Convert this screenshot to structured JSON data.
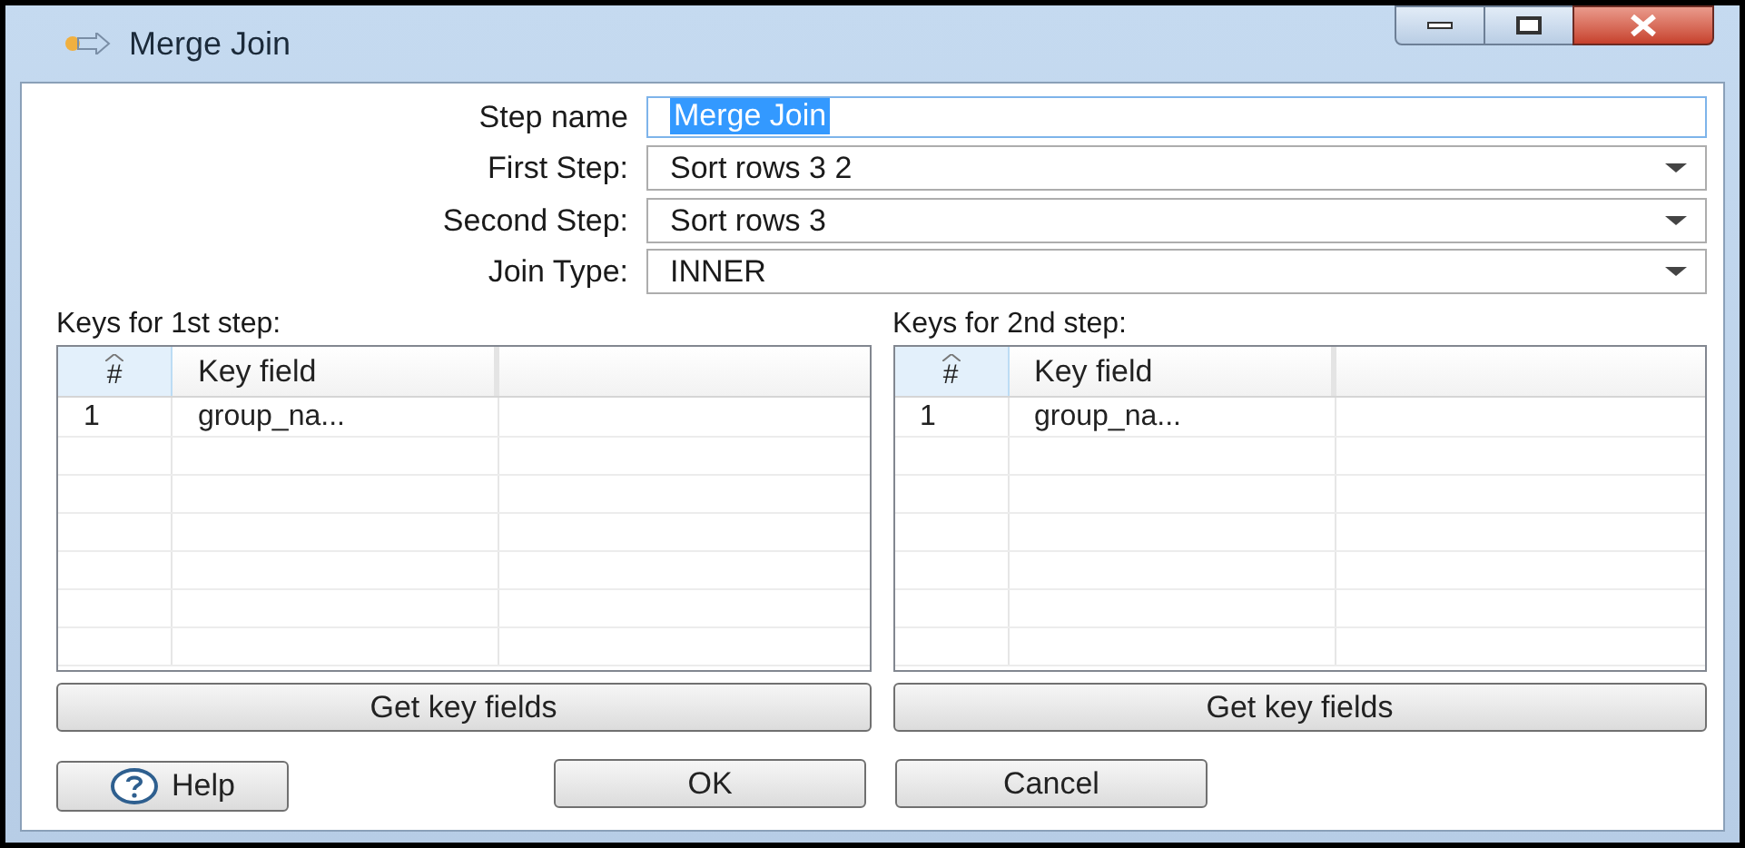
{
  "window": {
    "title": "Merge Join"
  },
  "fields": [
    {
      "kind": "text",
      "label": "Step name",
      "value": "Merge Join",
      "highlighted": true
    },
    {
      "kind": "select",
      "label": "First Step:",
      "value": "Sort rows 3 2"
    },
    {
      "kind": "select",
      "label": "Second Step:",
      "value": "Sort rows 3"
    },
    {
      "kind": "select",
      "label": "Join Type:",
      "value": "INNER"
    }
  ],
  "key_tables": [
    {
      "label": "Keys for 1st step:",
      "columns": [
        "#",
        "Key field"
      ],
      "rows": [
        [
          "1",
          "group_na..."
        ]
      ],
      "button": "Get key fields"
    },
    {
      "label": "Keys for 2nd step:",
      "columns": [
        "#",
        "Key field"
      ],
      "rows": [
        [
          "1",
          "group_na..."
        ]
      ],
      "button": "Get key fields"
    }
  ],
  "help_button": "Help",
  "buttons": [
    "OK",
    "Cancel"
  ]
}
